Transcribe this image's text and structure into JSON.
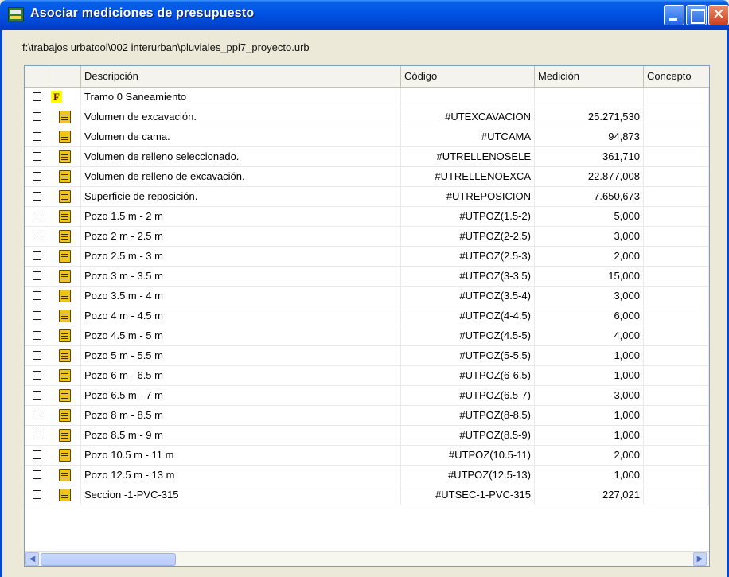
{
  "window": {
    "title": "Asociar mediciones de presupuesto",
    "close_glyph": "✕"
  },
  "file_path": "f:\\trabajos urbatool\\002 interurban\\pluviales_ppi7_proyecto.urb",
  "columns": {
    "descripcion": "Descripción",
    "codigo": "Código",
    "medicion": "Medición",
    "concepto": "Concepto"
  },
  "header_row": {
    "icon_letter": "F",
    "label": "Tramo 0 Saneamiento"
  },
  "rows": [
    {
      "descripcion": "Volumen de excavación.",
      "codigo": "#UTEXCAVACION",
      "medicion": "25.271,530",
      "concepto": ""
    },
    {
      "descripcion": "Volumen de cama.",
      "codigo": "#UTCAMA",
      "medicion": "94,873",
      "concepto": ""
    },
    {
      "descripcion": "Volumen de relleno seleccionado.",
      "codigo": "#UTRELLENOSELE",
      "medicion": "361,710",
      "concepto": ""
    },
    {
      "descripcion": "Volumen de relleno de excavación.",
      "codigo": "#UTRELLENOEXCA",
      "medicion": "22.877,008",
      "concepto": ""
    },
    {
      "descripcion": "Superficie de reposición.",
      "codigo": "#UTREPOSICION",
      "medicion": "7.650,673",
      "concepto": ""
    },
    {
      "descripcion": "Pozo 1.5 m - 2 m",
      "codigo": "#UTPOZ(1.5-2)",
      "medicion": "5,000",
      "concepto": ""
    },
    {
      "descripcion": "Pozo 2 m - 2.5 m",
      "codigo": "#UTPOZ(2-2.5)",
      "medicion": "3,000",
      "concepto": ""
    },
    {
      "descripcion": "Pozo 2.5 m - 3 m",
      "codigo": "#UTPOZ(2.5-3)",
      "medicion": "2,000",
      "concepto": ""
    },
    {
      "descripcion": "Pozo 3 m - 3.5 m",
      "codigo": "#UTPOZ(3-3.5)",
      "medicion": "15,000",
      "concepto": ""
    },
    {
      "descripcion": "Pozo 3.5 m - 4 m",
      "codigo": "#UTPOZ(3.5-4)",
      "medicion": "3,000",
      "concepto": ""
    },
    {
      "descripcion": "Pozo 4 m - 4.5 m",
      "codigo": "#UTPOZ(4-4.5)",
      "medicion": "6,000",
      "concepto": ""
    },
    {
      "descripcion": "Pozo 4.5 m - 5 m",
      "codigo": "#UTPOZ(4.5-5)",
      "medicion": "4,000",
      "concepto": ""
    },
    {
      "descripcion": "Pozo 5 m - 5.5 m",
      "codigo": "#UTPOZ(5-5.5)",
      "medicion": "1,000",
      "concepto": ""
    },
    {
      "descripcion": "Pozo 6 m - 6.5 m",
      "codigo": "#UTPOZ(6-6.5)",
      "medicion": "1,000",
      "concepto": ""
    },
    {
      "descripcion": "Pozo 6.5 m - 7 m",
      "codigo": "#UTPOZ(6.5-7)",
      "medicion": "3,000",
      "concepto": ""
    },
    {
      "descripcion": "Pozo 8 m - 8.5 m",
      "codigo": "#UTPOZ(8-8.5)",
      "medicion": "1,000",
      "concepto": ""
    },
    {
      "descripcion": "Pozo 8.5 m - 9 m",
      "codigo": "#UTPOZ(8.5-9)",
      "medicion": "1,000",
      "concepto": ""
    },
    {
      "descripcion": "Pozo 10.5 m - 11 m",
      "codigo": "#UTPOZ(10.5-11)",
      "medicion": "2,000",
      "concepto": ""
    },
    {
      "descripcion": "Pozo 12.5 m - 13 m",
      "codigo": "#UTPOZ(12.5-13)",
      "medicion": "1,000",
      "concepto": ""
    },
    {
      "descripcion": "Seccion -1-PVC-315",
      "codigo": "#UTSEC-1-PVC-315",
      "medicion": "227,021",
      "concepto": ""
    }
  ],
  "scroll": {
    "up": "▲",
    "down": "▼",
    "left": "◀",
    "right": "▶"
  }
}
